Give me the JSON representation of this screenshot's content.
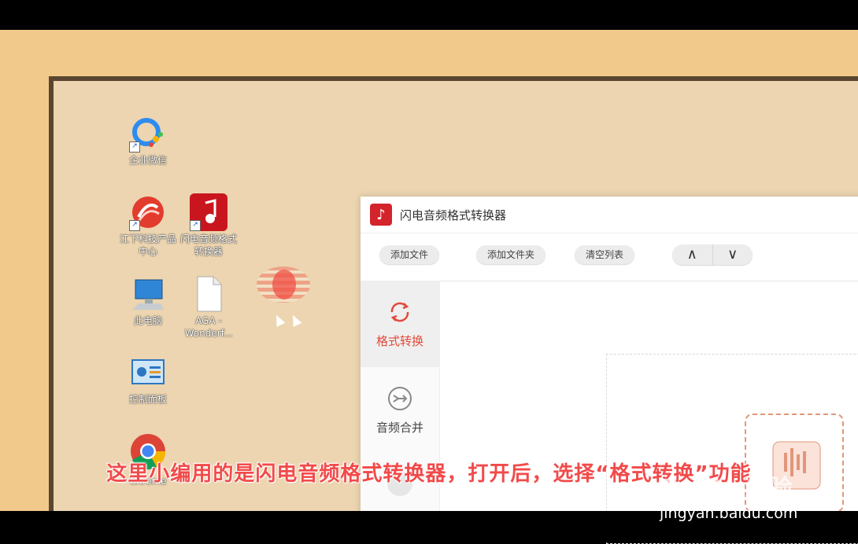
{
  "desktop": {
    "icons": [
      {
        "label": "企业微信",
        "icon": "wecom-icon"
      },
      {
        "label": "江下科技产品中心",
        "icon": "jiangxia-icon"
      },
      {
        "label": "闪电音频格式转换器",
        "icon": "audio-converter-icon"
      },
      {
        "label": "此电脑",
        "icon": "computer-icon"
      },
      {
        "label": "AGA - Wonderf...",
        "icon": "file-icon"
      },
      {
        "label": "控制面板",
        "icon": "control-panel-icon"
      },
      {
        "label": "Chrome",
        "icon": "chrome-icon"
      }
    ]
  },
  "app": {
    "title": "闪电音频格式转换器",
    "toolbar": {
      "add_file": "添加文件",
      "add_folder": "添加文件夹",
      "clear_list": "清空列表",
      "up": "∧",
      "down": "∨"
    },
    "sidebar": [
      {
        "label": "格式转换",
        "icon": "refresh-icon",
        "active": true
      },
      {
        "label": "音频合并",
        "icon": "merge-icon",
        "active": false
      }
    ]
  },
  "overlay": {
    "subtitle": "这里小编用的是闪电音频格式转换器，打开后，选择“格式转换”功能",
    "watermark": "Baidu 经验",
    "watermark_url": "jingyan.baidu.com"
  },
  "colors": {
    "accent": "#e24a3b",
    "logo": "#d3232b",
    "subtitle": "#f24a4a"
  }
}
